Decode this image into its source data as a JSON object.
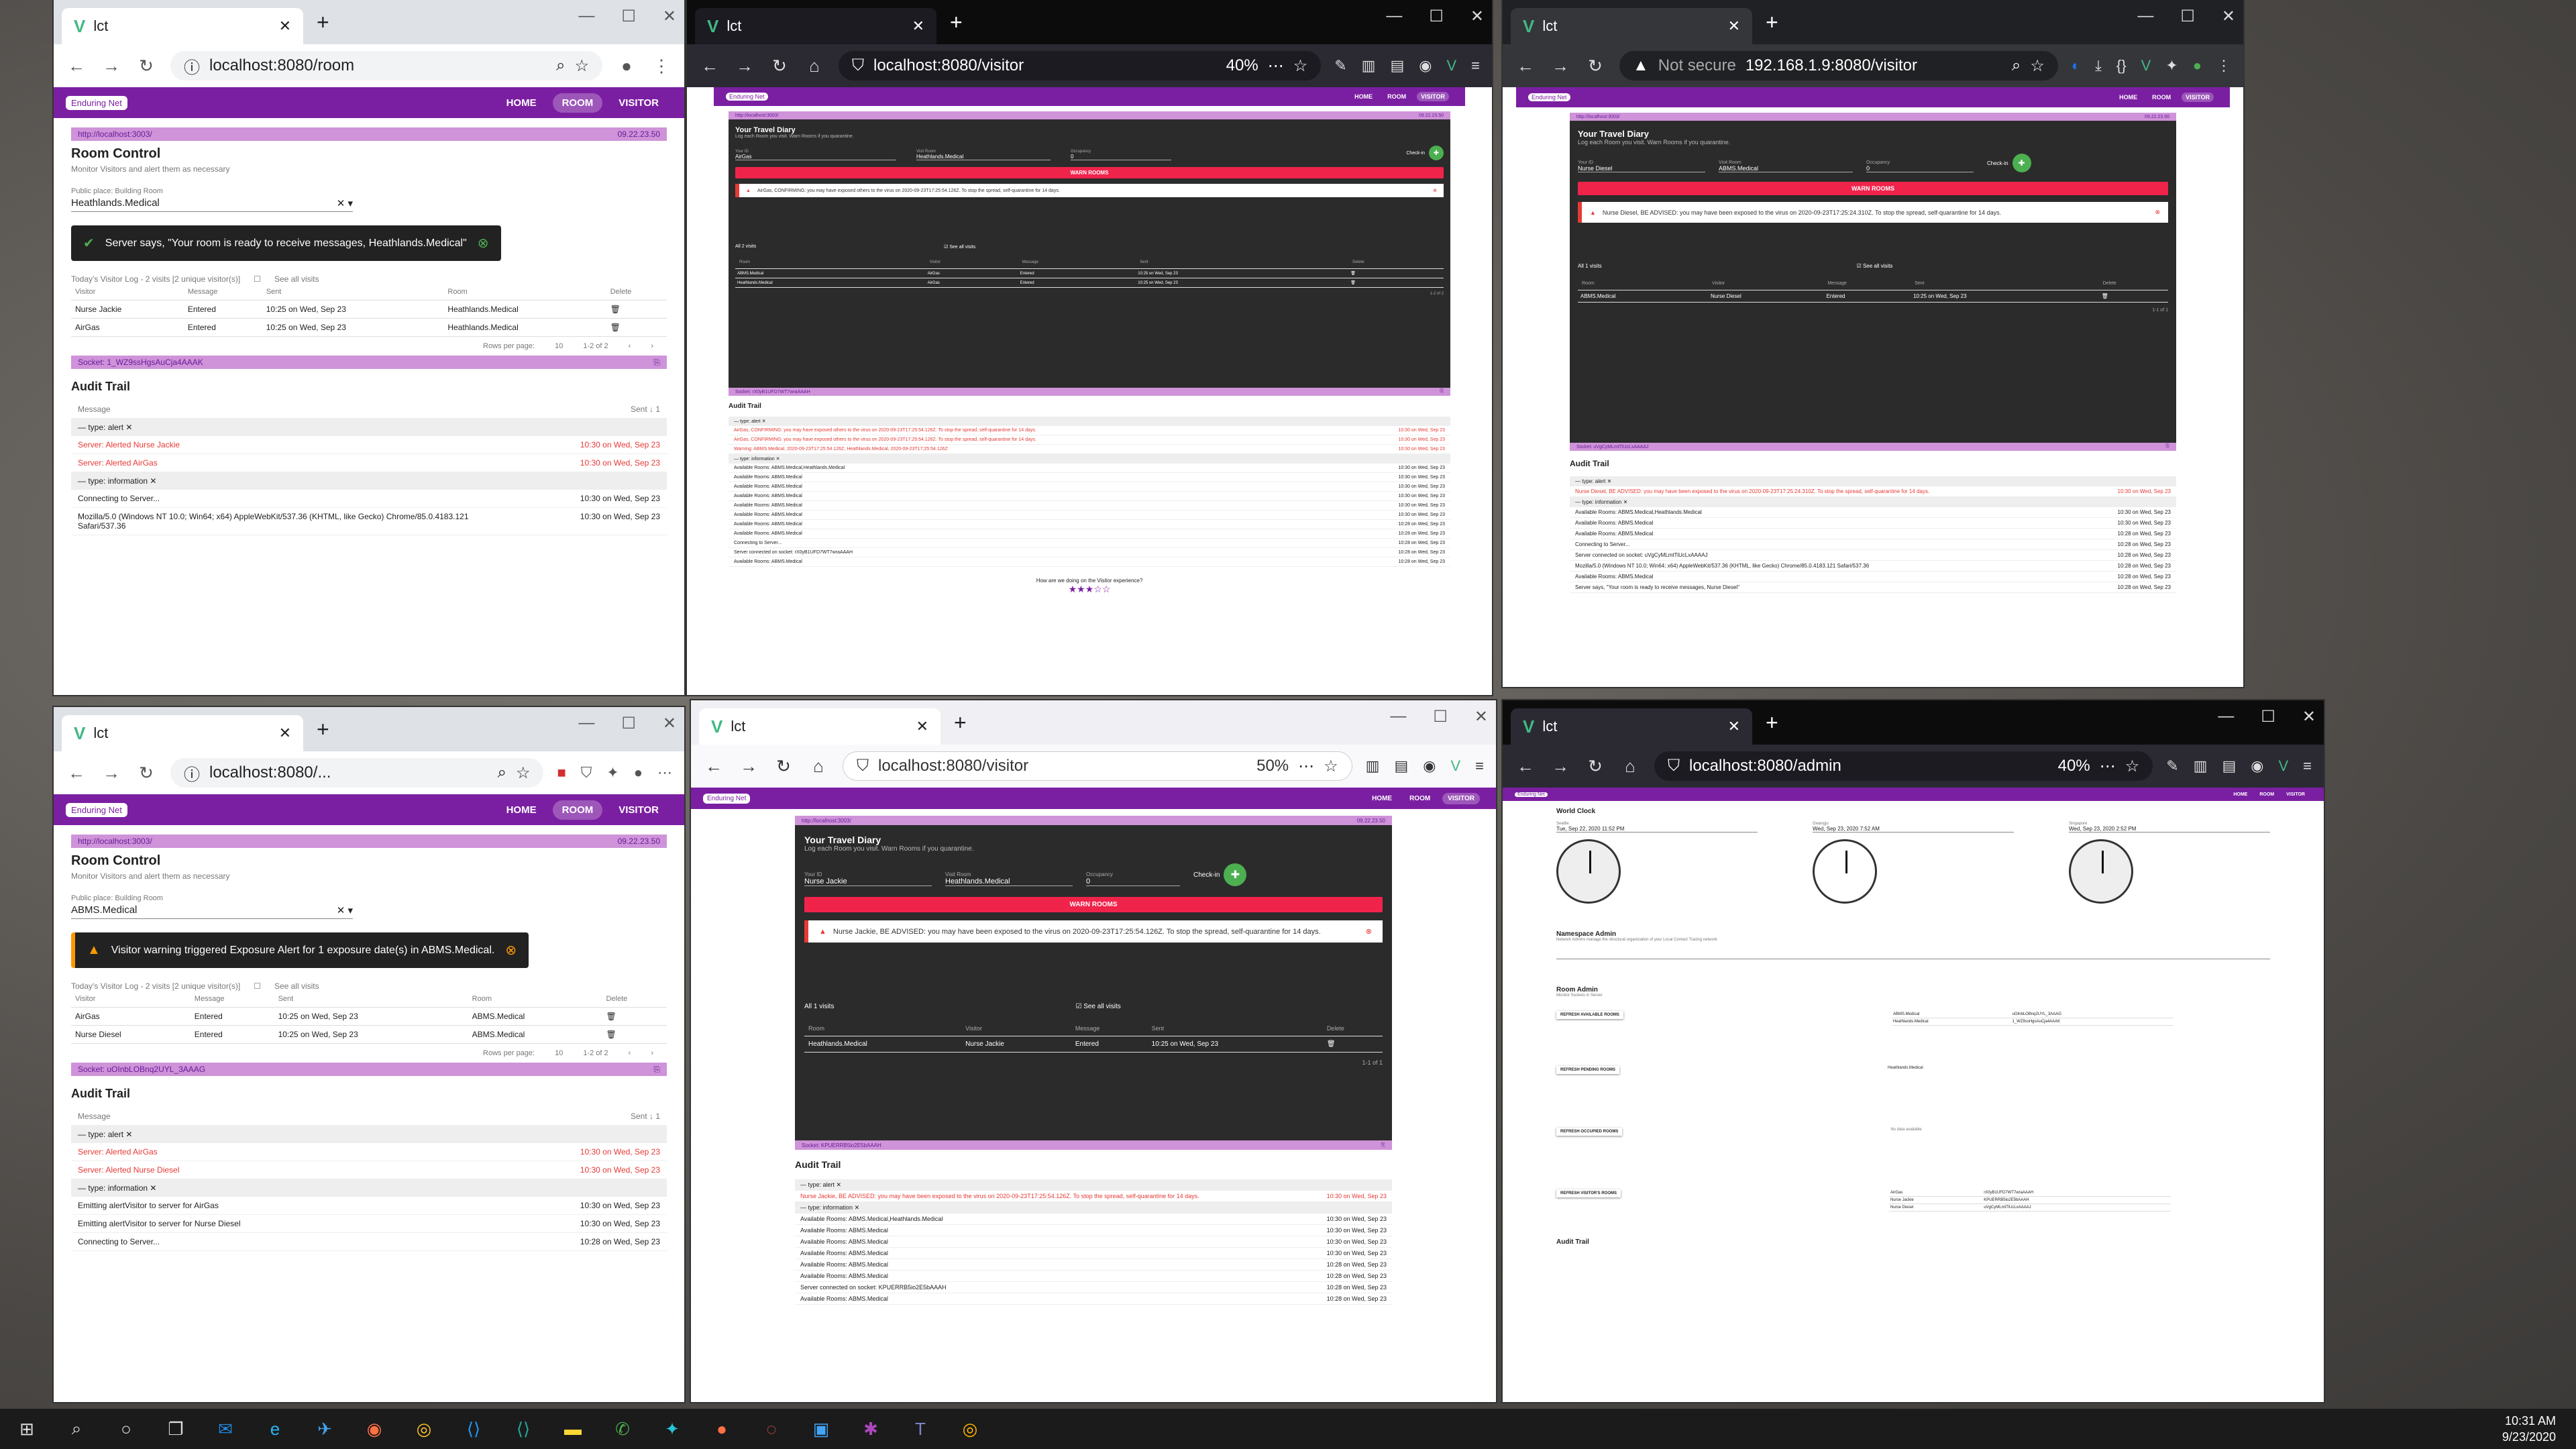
{
  "app": {
    "tab_title": "lct",
    "logo": "Enduring Net",
    "nav": [
      "HOME",
      "ROOM",
      "VISITOR"
    ]
  },
  "windows": {
    "w1": {
      "url": "localhost:8080/room",
      "server_url": "http://localhost:3003/",
      "version": "09.22.23.50",
      "title": "Room Control",
      "subtitle": "Monitor Visitors and alert them as necessary",
      "room_label": "Public place: Building Room",
      "room_value": "Heathlands.Medical",
      "toast": "Server says, \"Your room is ready to receive messages, Heathlands.Medical\"",
      "log_title": "Today's Visitor Log - 2 visits [2 unique visitor(s)]",
      "see_all": "See all visits",
      "cols": [
        "Visitor",
        "Message",
        "Sent",
        "Room",
        "Delete"
      ],
      "rows": [
        [
          "Nurse Jackie",
          "Entered",
          "10:25 on Wed, Sep 23",
          "Heathlands.Medical"
        ],
        [
          "AirGas",
          "Entered",
          "10:25 on Wed, Sep 23",
          "Heathlands.Medical"
        ]
      ],
      "rows_per_page": "Rows per page:",
      "rpp_value": "10",
      "page_range": "1-2 of 2",
      "socket": "Socket: 1_WZ9ssHgsAuCja4AAAK",
      "audit_title": "Audit Trail",
      "audit_cols": [
        "Message",
        "Sent ↓ 1"
      ],
      "group_alert": "type: alert",
      "group_info": "type: information",
      "alert_rows": [
        [
          "Server: Alerted Nurse Jackie",
          "10:30 on Wed, Sep 23"
        ],
        [
          "Server: Alerted AirGas",
          "10:30 on Wed, Sep 23"
        ]
      ],
      "info_rows": [
        [
          "Connecting to Server...",
          "10:30 on Wed, Sep 23"
        ],
        [
          "Mozilla/5.0 (Windows NT 10.0; Win64; x64) AppleWebKit/537.36 (KHTML, like Gecko) Chrome/85.0.4183.121 Safari/537.36",
          "10:30 on Wed, Sep 23"
        ]
      ]
    },
    "w2": {
      "url": "localhost:8080/visitor",
      "zoom": "40%",
      "server_url": "http://localhost:3003/",
      "version": "09.22.23.50",
      "title": "Your Travel Diary",
      "subtitle": "Log each Room you visit. Warn Rooms if you quarantine.",
      "your_id_label": "Your ID",
      "your_id": "AirGas",
      "visit_room_label": "Visit Room",
      "visit_room": "Heathlands.Medical",
      "occupancy_label": "Occupancy",
      "occupancy": "0",
      "checkin": "Check-in",
      "warn_button": "WARN ROOMS",
      "alert": "AirGas, CONFIRMING: you may have exposed others to the virus on 2020-09-23T17:25:54.126Z. To stop the spread, self-quarantine for 14 days.",
      "visits_title": "All 2 visits",
      "see_all": "See all visits",
      "cols": [
        "Room",
        "Visitor",
        "Message",
        "Sent",
        "Delete"
      ],
      "rows": [
        [
          "ABMS.Medical",
          "AirGas",
          "Entered",
          "10:25 on Wed, Sep 23"
        ],
        [
          "Heathlands.Medical",
          "AirGas",
          "Entered",
          "10:25 on Wed, Sep 23"
        ]
      ],
      "page_range": "1-2 of 2",
      "socket": "Socket: rX0yB1UFD7WT7wraAAAH",
      "audit_title": "Audit Trail",
      "alert_rows": [
        [
          "AirGas, CONFIRMING: you may have exposed others to the virus on 2020-09-23T17:25:54.126Z. To stop the spread, self-quarantine for 14 days.",
          "10:30 on Wed, Sep 23"
        ],
        [
          "AirGas, CONFIRMING: you may have exposed others to the virus on 2020-09-23T17:25:54.126Z. To stop the spread, self-quarantine for 14 days.",
          "10:30 on Wed, Sep 23"
        ],
        [
          "Warning: ABMS.Medical, 2020-09-23T17:25:54.126Z, Heathlands.Medical, 2020-09-23T17:25:54.126Z",
          "10:30 on Wed, Sep 23"
        ]
      ],
      "info_rows": [
        [
          "Available Rooms: ABMS.Medical,Heathlands.Medical",
          "10:30 on Wed, Sep 23"
        ],
        [
          "Available Rooms: ABMS.Medical",
          "10:30 on Wed, Sep 23"
        ],
        [
          "Available Rooms: ABMS.Medical",
          "10:30 on Wed, Sep 23"
        ],
        [
          "Available Rooms: ABMS.Medical",
          "10:30 on Wed, Sep 23"
        ],
        [
          "Available Rooms: ABMS.Medical",
          "10:30 on Wed, Sep 23"
        ],
        [
          "Available Rooms: ABMS.Medical",
          "10:30 on Wed, Sep 23"
        ],
        [
          "Available Rooms: ABMS.Medical",
          "10:28 on Wed, Sep 23"
        ],
        [
          "Available Rooms: ABMS.Medical",
          "10:28 on Wed, Sep 23"
        ],
        [
          "Connecting to Server...",
          "10:28 on Wed, Sep 23"
        ],
        [
          "Server connected on socket: rX0yB1UFD7WT7wraAAAH",
          "10:28 on Wed, Sep 23"
        ],
        [
          "Available Rooms: ABMS.Medical",
          "10:28 on Wed, Sep 23"
        ]
      ],
      "rating": "How are we doing on the Visitor experience?"
    },
    "w3": {
      "url": "192.168.1.9:8080/visitor",
      "not_secure": "Not secure",
      "server_url": "http://localhost:3003/",
      "version": "09.22.23.50",
      "title": "Your Travel Diary",
      "subtitle": "Log each Room you visit. Warn Rooms if you quarantine.",
      "your_id_label": "Your ID",
      "your_id": "Nurse Diesel",
      "visit_room_label": "Visit Room",
      "visit_room": "ABMS.Medical",
      "occupancy_label": "Occupancy",
      "occupancy": "0",
      "checkin": "Check-in",
      "warn_button": "WARN ROOMS",
      "alert": "Nurse Diesel, BE ADVISED: you may have been exposed to the virus on 2020-09-23T17:25:24.310Z. To stop the spread, self-quarantine for 14 days.",
      "visits_title": "All 1 visits",
      "see_all": "See all visits",
      "cols": [
        "Room",
        "Visitor",
        "Message",
        "Sent",
        "Delete"
      ],
      "rows": [
        [
          "ABMS.Medical",
          "Nurse Diesel",
          "Entered",
          "10:25 on Wed, Sep 23"
        ]
      ],
      "page_range": "1-1 of 1",
      "socket": "Socket: uVgCyMLmtTiUcLxAAAAJ",
      "audit_title": "Audit Trail",
      "alert_rows": [
        [
          "Nurse Diesel, BE ADVISED: you may have been exposed to the virus on 2020-09-23T17:25:24.310Z. To stop the spread, self-quarantine for 14 days.",
          "10:30 on Wed, Sep 23"
        ]
      ],
      "info_rows": [
        [
          "Available Rooms: ABMS.Medical,Heathlands.Medical",
          "10:30 on Wed, Sep 23"
        ],
        [
          "Available Rooms: ABMS.Medical",
          "10:30 on Wed, Sep 23"
        ],
        [
          "Available Rooms: ABMS.Medical",
          "10:28 on Wed, Sep 23"
        ],
        [
          "Connecting to Server...",
          "10:28 on Wed, Sep 23"
        ],
        [
          "Server connected on socket: uVgCyMLmtTiUcLxAAAAJ",
          "10:28 on Wed, Sep 23"
        ],
        [
          "Mozilla/5.0 (Windows NT 10.0; Win64; x64) AppleWebKit/537.36 (KHTML, like Gecko) Chrome/85.0.4183.121 Safari/537.36",
          "10:28 on Wed, Sep 23"
        ],
        [
          "Available Rooms: ABMS.Medical",
          "10:28 on Wed, Sep 23"
        ],
        [
          "Server says, \"Your room is ready to receive messages, Nurse Diesel\"",
          "10:28 on Wed, Sep 23"
        ]
      ]
    },
    "w4": {
      "url": "localhost:8080/...",
      "server_url": "http://localhost:3003/",
      "version": "09.22.23.50",
      "title": "Room Control",
      "subtitle": "Monitor Visitors and alert them as necessary",
      "room_label": "Public place: Building Room",
      "room_value": "ABMS.Medical",
      "toast": "Visitor warning triggered Exposure Alert for 1 exposure date(s) in ABMS.Medical.",
      "log_title": "Today's Visitor Log - 2 visits [2 unique visitor(s)]",
      "see_all": "See all visits",
      "cols": [
        "Visitor",
        "Message",
        "Sent",
        "Room",
        "Delete"
      ],
      "rows": [
        [
          "AirGas",
          "Entered",
          "10:25 on Wed, Sep 23",
          "ABMS.Medical"
        ],
        [
          "Nurse Diesel",
          "Entered",
          "10:25 on Wed, Sep 23",
          "ABMS.Medical"
        ]
      ],
      "rows_per_page": "Rows per page:",
      "rpp_value": "10",
      "page_range": "1-2 of 2",
      "socket": "Socket: uOInbLOBnq2UYL_3AAAG",
      "audit_title": "Audit Trail",
      "audit_cols": [
        "Message",
        "Sent ↓ 1"
      ],
      "group_alert": "type: alert",
      "group_info": "type: information",
      "alert_rows": [
        [
          "Server: Alerted AirGas",
          "10:30 on Wed, Sep 23"
        ],
        [
          "Server: Alerted Nurse Diesel",
          "10:30 on Wed, Sep 23"
        ]
      ],
      "info_rows": [
        [
          "Emitting alertVisitor to server for AirGas",
          "10:30 on Wed, Sep 23"
        ],
        [
          "Emitting alertVisitor to server for Nurse Diesel",
          "10:30 on Wed, Sep 23"
        ],
        [
          "Connecting to Server...",
          "10:28 on Wed, Sep 23"
        ]
      ]
    },
    "w5": {
      "url": "localhost:8080/visitor",
      "zoom": "50%",
      "server_url": "http://localhost:3003/",
      "version": "09.22.23.50",
      "title": "Your Travel Diary",
      "subtitle": "Log each Room you visit. Warn Rooms if you quarantine.",
      "your_id_label": "Your ID",
      "your_id": "Nurse Jackie",
      "visit_room_label": "Visit Room",
      "visit_room": "Heathlands.Medical",
      "occupancy_label": "Occupancy",
      "occupancy": "0",
      "checkin": "Check-in",
      "warn_button": "WARN ROOMS",
      "alert": "Nurse Jackie, BE ADVISED: you may have been exposed to the virus on 2020-09-23T17:25:54.126Z. To stop the spread, self-quarantine for 14 days.",
      "visits_title": "All 1 visits",
      "see_all": "See all visits",
      "cols": [
        "Room",
        "Visitor",
        "Message",
        "Sent",
        "Delete"
      ],
      "rows": [
        [
          "Heathlands.Medical",
          "Nurse Jackie",
          "Entered",
          "10:25 on Wed, Sep 23"
        ]
      ],
      "page_range": "1-1 of 1",
      "socket": "Socket: KPUERRB5io2E5bAAAH",
      "audit_title": "Audit Trail",
      "alert_rows": [
        [
          "Nurse Jackie, BE ADVISED: you may have been exposed to the virus on 2020-09-23T17:25:54.126Z. To stop the spread, self-quarantine for 14 days.",
          "10:30 on Wed, Sep 23"
        ]
      ],
      "info_rows": [
        [
          "Available Rooms: ABMS.Medical,Heathlands.Medical",
          "10:30 on Wed, Sep 23"
        ],
        [
          "Available Rooms: ABMS.Medical",
          "10:30 on Wed, Sep 23"
        ],
        [
          "Available Rooms: ABMS.Medical",
          "10:30 on Wed, Sep 23"
        ],
        [
          "Available Rooms: ABMS.Medical",
          "10:30 on Wed, Sep 23"
        ],
        [
          "Available Rooms: ABMS.Medical",
          "10:28 on Wed, Sep 23"
        ],
        [
          "Available Rooms: ABMS.Medical",
          "10:28 on Wed, Sep 23"
        ],
        [
          "Server connected on socket: KPUERRB5io2E5bAAAH",
          "10:28 on Wed, Sep 23"
        ],
        [
          "Available Rooms: ABMS.Medical",
          "10:28 on Wed, Sep 23"
        ]
      ]
    },
    "w6": {
      "url": "localhost:8080/admin",
      "zoom": "40%",
      "world_clock": "World Clock",
      "clocks": [
        [
          "Seattle",
          "Tue, Sep 22, 2020 11:52 PM"
        ],
        [
          "Gwangju",
          "Wed, Sep 23, 2020 7:52 AM"
        ],
        [
          "Singapore",
          "Wed, Sep 23, 2020 2:52 PM"
        ]
      ],
      "namespace_title": "Namespace Admin",
      "namespace_sub": "Network Admins manage the structural organization of your Local Contact Tracing network",
      "room_admin": "Room Admin",
      "room_admin_sub": "Monitor Sockets in Server",
      "buttons": [
        "REFRESH AVAILABLE ROOMS",
        "REFRESH PENDING ROOMS",
        "REFRESH OCCUPIED ROOMS",
        "REFRESH VISITOR'S ROOMS"
      ],
      "available_rooms": [
        [
          "ABMS.Medical",
          "uOInbLOBnq2UYL_3AAAG"
        ],
        [
          "Heathlands.Medical",
          "1_WZ9ssHgsAuCja4AAAK"
        ]
      ],
      "pending_rooms": [
        "Heathlands.Medical"
      ],
      "no_data": "No data available",
      "visitors": [
        [
          "AirGas",
          "rX0yB1UFD7WT7wraAAAH"
        ],
        [
          "Nurse Jackie",
          "KPUERRB5io2E5bAAAH"
        ],
        [
          "Nurse Diesel",
          "uVgCyMLmtTiUcLxAAAAJ"
        ]
      ],
      "audit_title": "Audit Trail"
    }
  },
  "taskbar": {
    "time": "10:31 AM",
    "date": "9/23/2020"
  }
}
